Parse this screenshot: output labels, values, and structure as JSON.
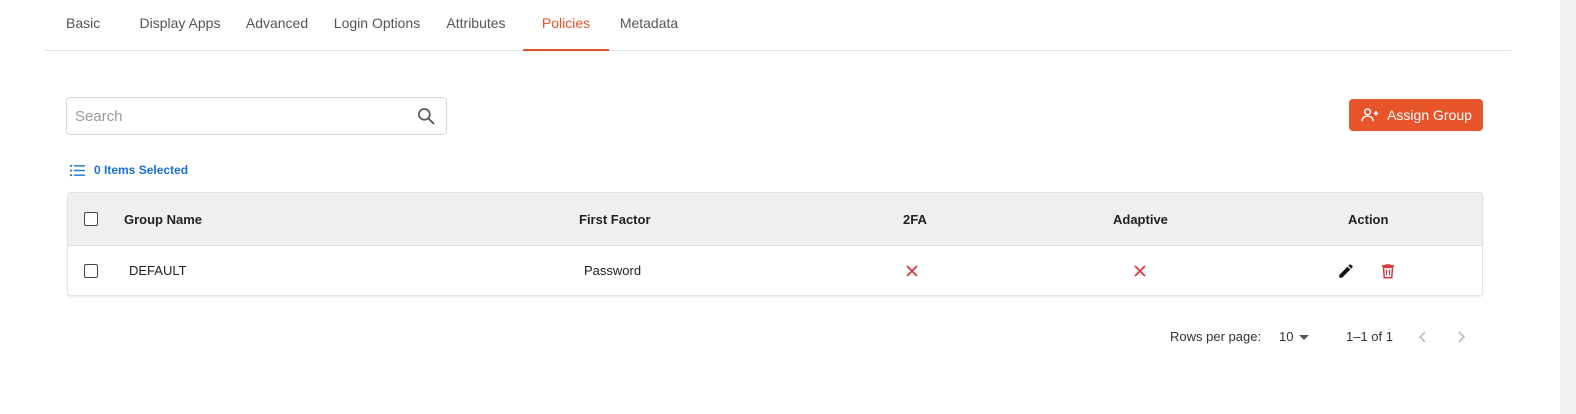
{
  "tabs": [
    {
      "label": "Basic"
    },
    {
      "label": "Display Apps"
    },
    {
      "label": "Advanced"
    },
    {
      "label": "Login Options"
    },
    {
      "label": "Attributes"
    },
    {
      "label": "Policies",
      "active": true
    },
    {
      "label": "Metadata"
    }
  ],
  "search": {
    "placeholder": "Search",
    "value": ""
  },
  "assign_button": {
    "label": "Assign Group"
  },
  "selection": {
    "label": "0 Items Selected"
  },
  "table": {
    "columns": [
      "Group Name",
      "First Factor",
      "2FA",
      "Adaptive",
      "Action"
    ],
    "rows": [
      {
        "group_name": "DEFAULT",
        "first_factor": "Password",
        "two_fa": false,
        "adaptive": false
      }
    ]
  },
  "pagination": {
    "rows_per_page_label": "Rows per page:",
    "rows_per_page_value": "10",
    "range": "1–1 of 1"
  },
  "colors": {
    "accent": "#e8542a",
    "link": "#1a6fd8",
    "cross": "#d9393e",
    "delete": "#d9393e"
  }
}
